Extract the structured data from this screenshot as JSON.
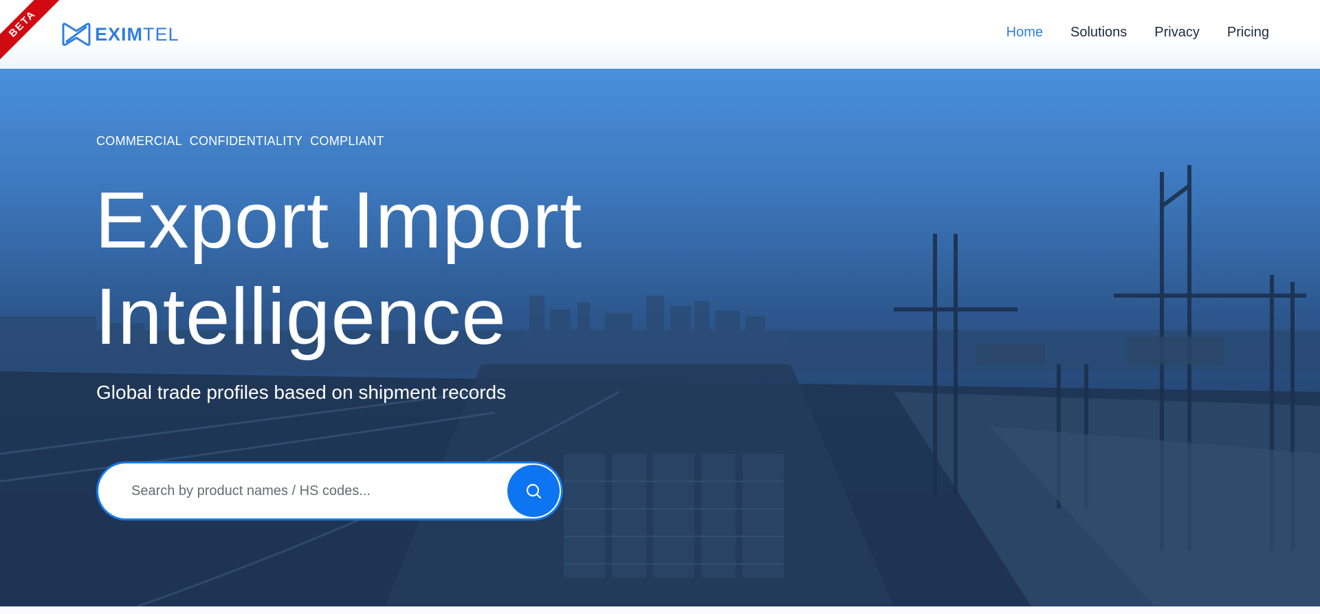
{
  "header": {
    "beta_label": "BETA",
    "logo": {
      "bold": "EXIM",
      "regular": "TEL",
      "icon": "eximtel-logo-icon",
      "color": "#2f7ee0"
    },
    "nav": [
      {
        "label": "Home",
        "active": true
      },
      {
        "label": "Solutions",
        "active": false
      },
      {
        "label": "Privacy",
        "active": false
      },
      {
        "label": "Pricing",
        "active": false
      }
    ]
  },
  "hero": {
    "tagline": "COMMERCIAL CONFIDENTIALITY COMPLIANT",
    "title_line1": "Export Import",
    "title_line2": "Intelligence",
    "subtitle": "Global trade profiles based on shipment records",
    "search": {
      "placeholder": "Search by product names / HS codes...",
      "value": "",
      "button_icon": "search-icon"
    },
    "background": "port-cityscape-image"
  },
  "colors": {
    "accent": "#2f7ee0",
    "search_button": "#0d74f2",
    "beta_ribbon": "#d10a11"
  }
}
